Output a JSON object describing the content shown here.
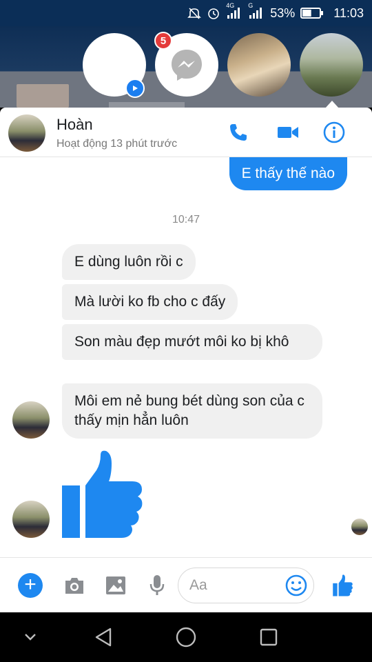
{
  "status_bar": {
    "network_label": "4G",
    "network2_label": "G",
    "battery_percent": "53%",
    "time": "11:03",
    "battery_level": 0.53
  },
  "chat_heads": {
    "unread_count": "5",
    "icons": [
      "video-icon",
      "messenger-icon"
    ]
  },
  "header": {
    "contact_name": "Hoàn",
    "contact_status": "Hoạt động 13 phút trước",
    "icons": [
      "phone-icon",
      "video-camera-icon",
      "info-icon"
    ]
  },
  "conversation": {
    "outgoing_message": "E thấy thế nào",
    "timestamp": "10:47",
    "incoming_messages": [
      {
        "text": "E dùng luôn rồi c"
      },
      {
        "text": "Mà lười ko fb cho c đấy"
      },
      {
        "text": "Son màu đẹp mướt môi ko bị khô"
      },
      {
        "text": "Môi em nẻ bung bét dùng son của c thấy mịn hẳn luôn"
      }
    ],
    "sticker": "thumbs-up-icon"
  },
  "composer": {
    "placeholder": "Aa",
    "icons": [
      "plus-icon",
      "camera-icon",
      "image-icon",
      "microphone-icon",
      "emoji-icon",
      "thumbs-up-icon"
    ]
  },
  "colors": {
    "accent": "#1e88f0",
    "status_bar": "#0b2e57",
    "incoming_bubble": "#f0f0f0",
    "badge": "#e43b3b"
  },
  "nav_bar": {
    "icons": [
      "chevron-down-icon",
      "back-icon",
      "home-icon",
      "recents-icon"
    ]
  }
}
